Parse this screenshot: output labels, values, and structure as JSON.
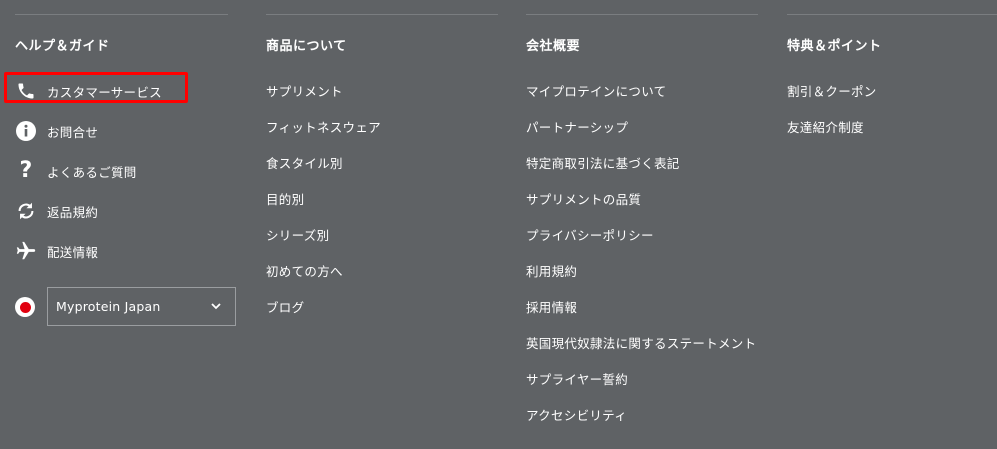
{
  "help": {
    "title": "ヘルプ＆ガイド",
    "items": [
      {
        "label": "カスタマーサービス",
        "icon": "phone-icon"
      },
      {
        "label": "お問合せ",
        "icon": "info-icon"
      },
      {
        "label": "よくあるご質問",
        "icon": "question-icon"
      },
      {
        "label": "返品規約",
        "icon": "refresh-icon"
      },
      {
        "label": "配送情報",
        "icon": "airplane-icon"
      }
    ],
    "region": {
      "selected": "Myprotein Japan",
      "flag": "japan-flag-icon"
    }
  },
  "products": {
    "title": "商品について",
    "links": [
      "サプリメント",
      "フィットネスウェア",
      "食スタイル別",
      "目的別",
      "シリーズ別",
      "初めての方へ",
      "ブログ"
    ]
  },
  "company": {
    "title": "会社概要",
    "links": [
      "マイプロテインについて",
      "パートナーシップ",
      "特定商取引法に基づく表記",
      "サプリメントの品質",
      "プライバシーポリシー",
      "利用規約",
      "採用情報",
      "英国現代奴隷法に関するステートメント",
      "サプライヤー誓約",
      "アクセシビリティ"
    ]
  },
  "perks": {
    "title": "特典＆ポイント",
    "links": [
      "割引＆クーポン",
      "友達紹介制度"
    ]
  },
  "colors": {
    "background": "#5f6265",
    "text": "#ffffff",
    "highlight": "#ff0000",
    "flag_red": "#e1000f"
  }
}
